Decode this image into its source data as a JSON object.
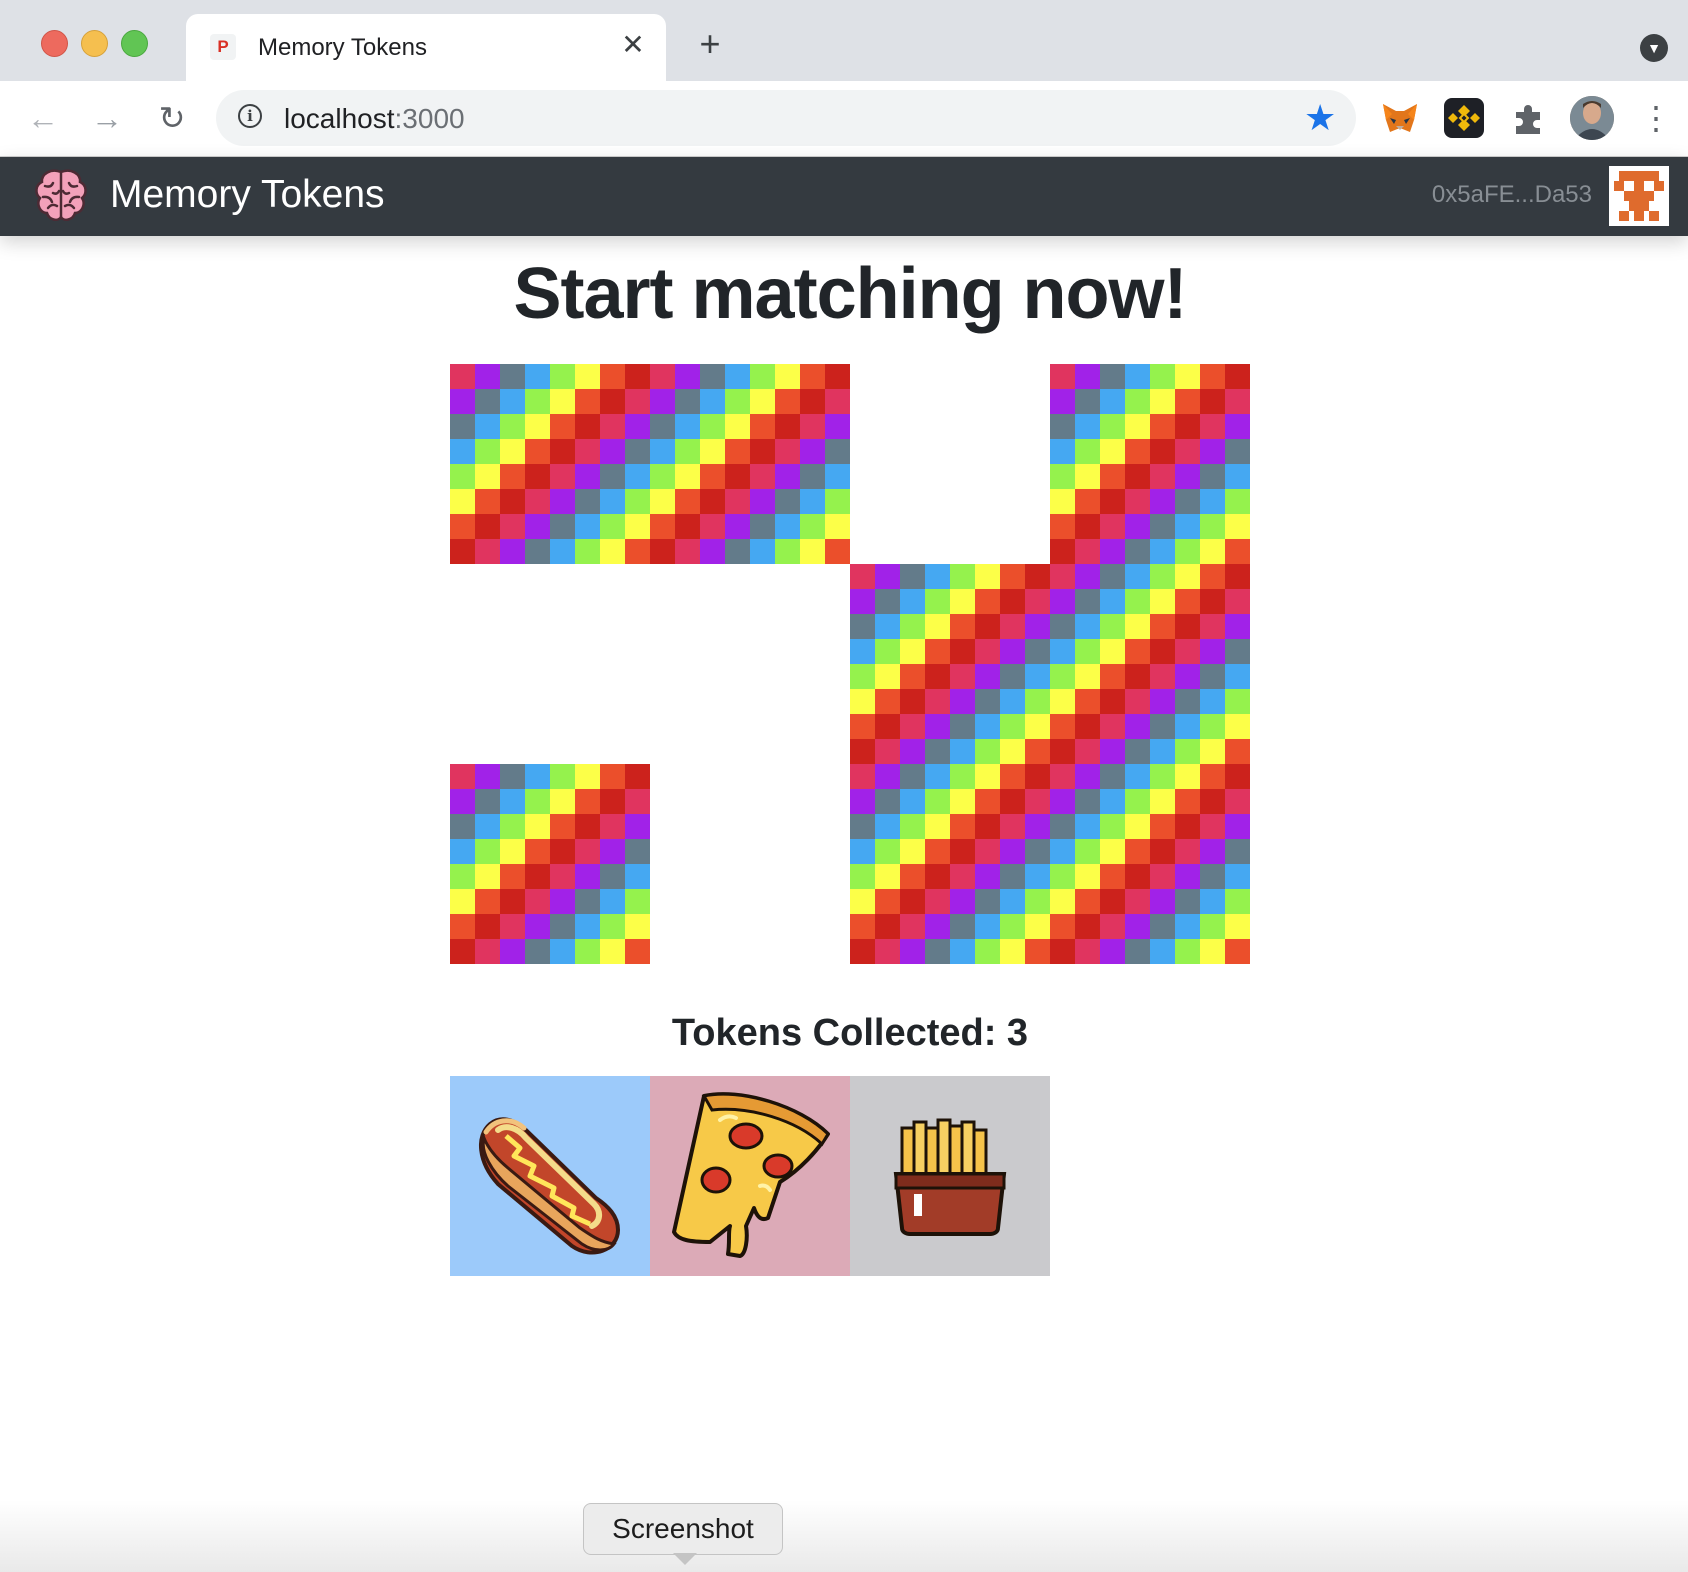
{
  "browser": {
    "tab_title": "Memory Tokens",
    "tab_favicon_letter": "P",
    "tab_close_glyph": "✕",
    "new_tab_glyph": "+",
    "url_host": "localhost",
    "url_port": ":3000"
  },
  "navbar": {
    "brand_name": "Memory Tokens",
    "account": "0x5aFE...Da53"
  },
  "game": {
    "heading": "Start matching now!",
    "columns": 4,
    "rows": 3,
    "card_back": "rainbow-checker",
    "cards": [
      {
        "row": 0,
        "col": 0,
        "state": "hidden"
      },
      {
        "row": 0,
        "col": 1,
        "state": "hidden"
      },
      {
        "row": 0,
        "col": 2,
        "state": "matched"
      },
      {
        "row": 0,
        "col": 3,
        "state": "hidden"
      },
      {
        "row": 1,
        "col": 0,
        "state": "matched"
      },
      {
        "row": 1,
        "col": 1,
        "state": "matched"
      },
      {
        "row": 1,
        "col": 2,
        "state": "hidden"
      },
      {
        "row": 1,
        "col": 3,
        "state": "hidden"
      },
      {
        "row": 2,
        "col": 0,
        "state": "hidden"
      },
      {
        "row": 2,
        "col": 1,
        "state": "matched"
      },
      {
        "row": 2,
        "col": 2,
        "state": "hidden"
      },
      {
        "row": 2,
        "col": 3,
        "state": "hidden"
      }
    ],
    "checker_colors": [
      "#e0345f",
      "#a122e8",
      "#637b8a",
      "#45a8f2",
      "#95f24d",
      "#fcff48",
      "#eb4f2b",
      "#cc221c"
    ]
  },
  "collection": {
    "label": "Tokens Collected: 3",
    "tokens": [
      {
        "icon": "hotdog-icon",
        "bg": "#9ccafa"
      },
      {
        "icon": "pizza-icon",
        "bg": "#dcaab7"
      },
      {
        "icon": "fries-icon",
        "bg": "#cacacd"
      }
    ]
  },
  "tooltip": {
    "label": "Screenshot"
  }
}
